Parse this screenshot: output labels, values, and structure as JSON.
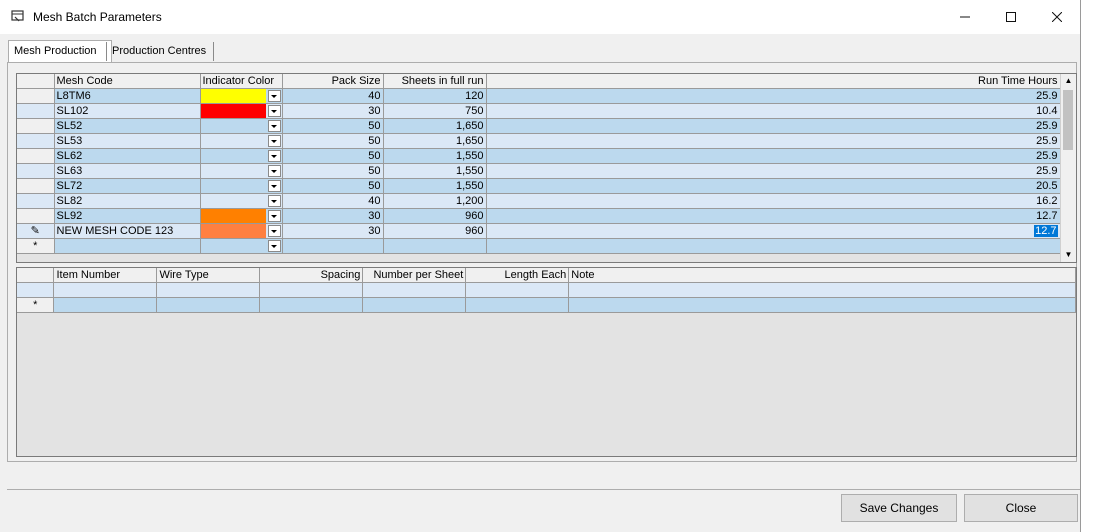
{
  "window": {
    "title": "Mesh Batch Parameters"
  },
  "tabs": [
    {
      "label": "Mesh Production"
    },
    {
      "label": "Production Centres"
    }
  ],
  "mesh_grid": {
    "columns": [
      "Mesh Code",
      "Indicator Color",
      "Pack Size",
      "Sheets in full run",
      "Run Time Hours"
    ],
    "rows": [
      {
        "code": "L8TM6",
        "color": "#ffff00",
        "pack": "40",
        "sheets": "120",
        "hours": "25.9"
      },
      {
        "code": "SL102",
        "color": "#ff0000",
        "pack": "30",
        "sheets": "750",
        "hours": "10.4"
      },
      {
        "code": "SL52",
        "color": "",
        "pack": "50",
        "sheets": "1,650",
        "hours": "25.9"
      },
      {
        "code": "SL53",
        "color": "",
        "pack": "50",
        "sheets": "1,650",
        "hours": "25.9"
      },
      {
        "code": "SL62",
        "color": "",
        "pack": "50",
        "sheets": "1,550",
        "hours": "25.9"
      },
      {
        "code": "SL63",
        "color": "",
        "pack": "50",
        "sheets": "1,550",
        "hours": "25.9"
      },
      {
        "code": "SL72",
        "color": "",
        "pack": "50",
        "sheets": "1,550",
        "hours": "20.5"
      },
      {
        "code": "SL82",
        "color": "",
        "pack": "40",
        "sheets": "1,200",
        "hours": "16.2"
      },
      {
        "code": "SL92",
        "color": "#ff8000",
        "pack": "30",
        "sheets": "960",
        "hours": "12.7"
      },
      {
        "code": "NEW MESH CODE 123",
        "color": "#ff8040",
        "pack": "30",
        "sheets": "960",
        "hours": "12.7"
      }
    ],
    "edit_marker": "✎",
    "new_row_marker": "*"
  },
  "detail_grid": {
    "columns": [
      "Item Number",
      "Wire Type",
      "Spacing",
      "Number per Sheet",
      "Length Each",
      "Note"
    ],
    "new_row_marker": "*"
  },
  "buttons": {
    "save": "Save Changes",
    "close": "Close"
  }
}
